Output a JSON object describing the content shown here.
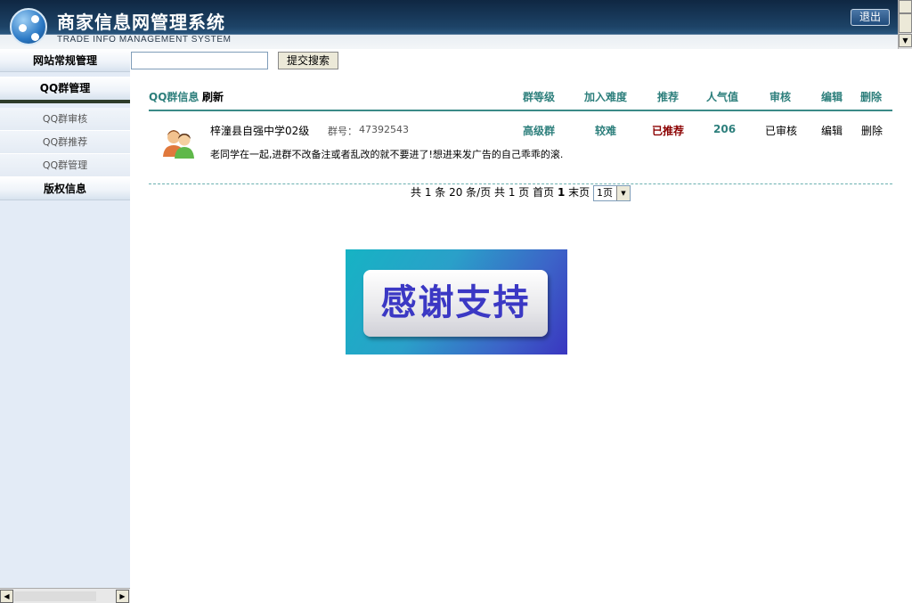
{
  "header": {
    "title": "商家信息网管理系统",
    "subtitle": "TRADE INFO MANAGEMENT SYSTEM",
    "logout_label": "退出"
  },
  "sidebar": {
    "site_admin": "网站常规管理",
    "qq_group_admin": "QQ群管理",
    "items": [
      {
        "label": "QQ群审核"
      },
      {
        "label": "QQ群推荐"
      },
      {
        "label": "QQ群管理"
      }
    ],
    "copyright": "版权信息"
  },
  "search": {
    "value": "",
    "placeholder": "",
    "submit_label": "提交搜索"
  },
  "list": {
    "headers": {
      "info": "QQ群信息",
      "refresh": "刷新",
      "level": "群等级",
      "difficulty": "加入难度",
      "recommend": "推荐",
      "popularity": "人气值",
      "review": "审核",
      "edit": "编辑",
      "delete": "删除"
    },
    "rows": [
      {
        "name": "梓潼县自强中学02级",
        "number_label": "群号：",
        "number": "47392543",
        "description": "老同学在一起,进群不改备注或者乱改的就不要进了!想进来发广告的自己乖乖的滚.",
        "level": "高级群",
        "difficulty": "较难",
        "recommend": "已推荐",
        "popularity": "206",
        "review": "已审核",
        "edit": "编辑",
        "delete": "删除"
      }
    ]
  },
  "pager": {
    "text": "共 1 条  20 条/页  共 1 页 首页",
    "current": "1",
    "last": "末页",
    "select_value": "1页"
  },
  "banner": {
    "text": "感谢支持"
  },
  "colors": {
    "teal": "#2d7f7c",
    "recommend_red": "#8b0000",
    "banner_text": "#3b38c4"
  }
}
